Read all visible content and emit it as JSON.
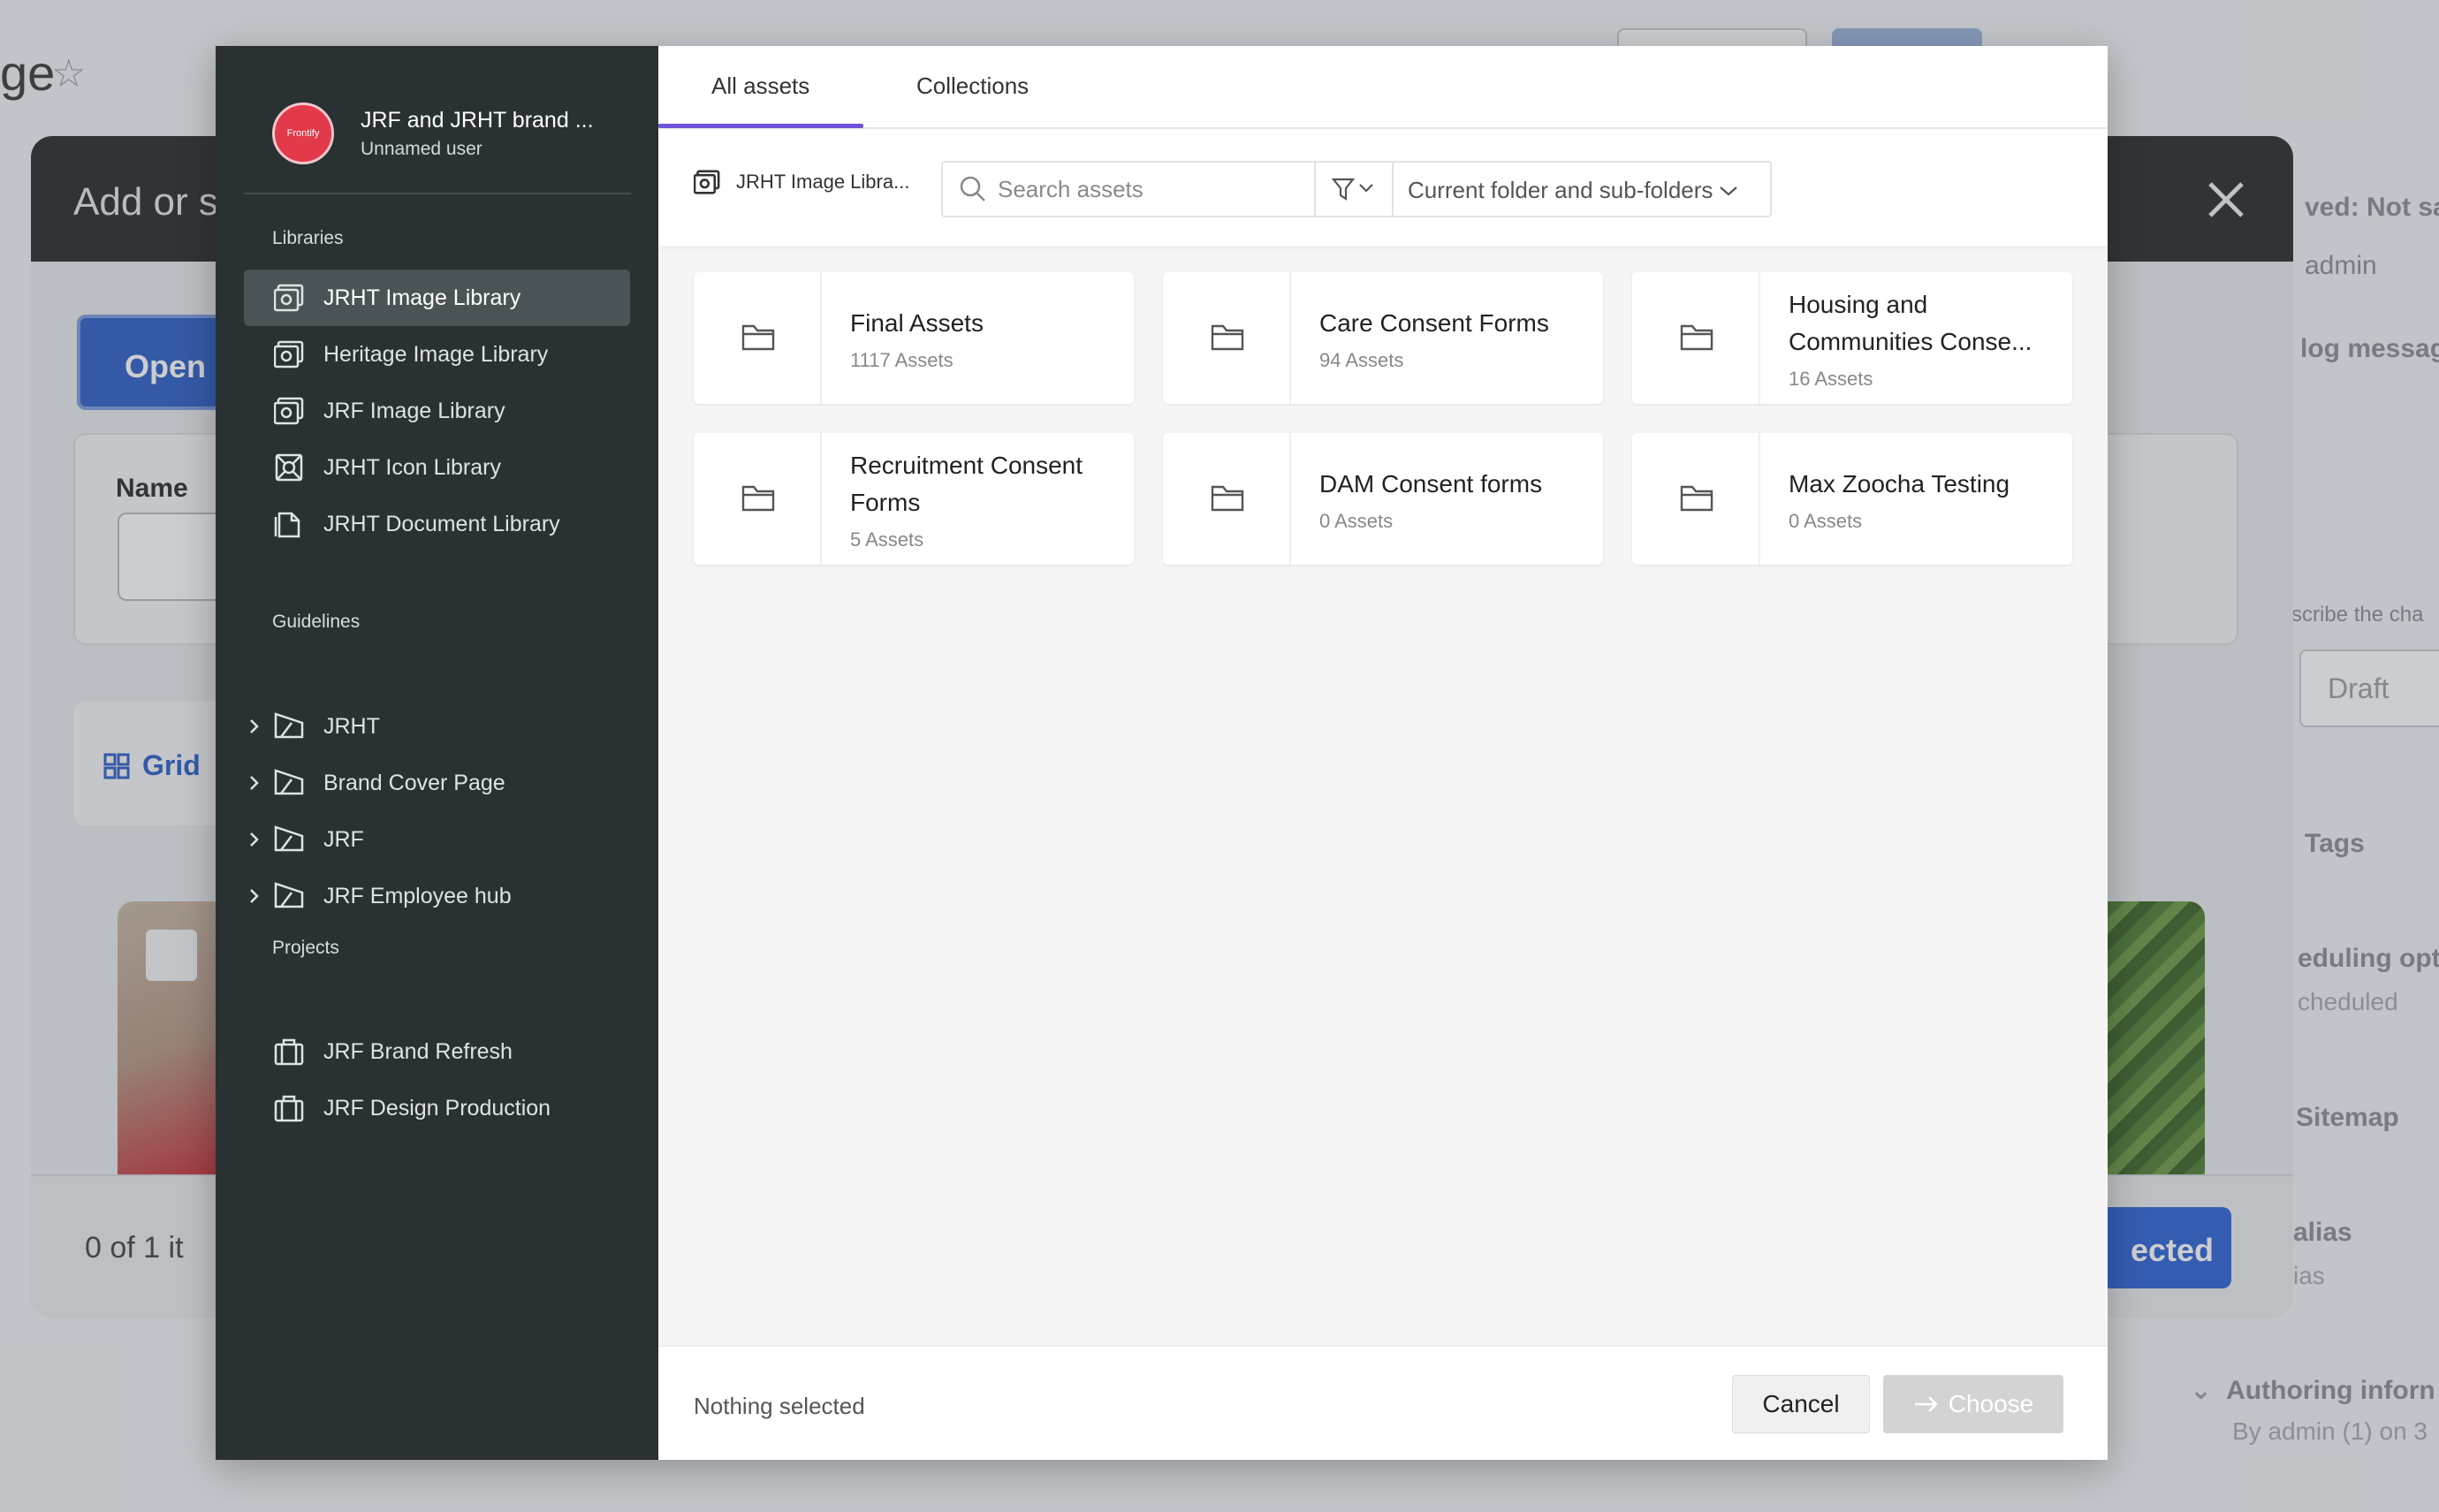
{
  "background_page": {
    "title_fragment": "ge",
    "right_texts": [
      "ved: Not sa",
      "admin",
      "log messag",
      "scribe the cha",
      "Draft",
      "Tags",
      "eduling optic",
      "cheduled",
      "Sitemap",
      "alias",
      "ias",
      "Authoring inforn",
      "By admin (1) on 3"
    ]
  },
  "middle_modal": {
    "title": "Add or se",
    "open_button_label": "Open F",
    "name_label": "Name",
    "grid_label": "Grid",
    "count_text": "0 of 1 it",
    "select_button_label": "ected"
  },
  "sidebar": {
    "brand": {
      "name": "JRF and JRHT brand ...",
      "user": "Unnamed user",
      "logo_text": "Frontify"
    },
    "libraries_title": "Libraries",
    "libraries": [
      {
        "label": "JRHT Image Library",
        "icon": "image-library-icon",
        "active": true
      },
      {
        "label": "Heritage Image Library",
        "icon": "image-library-icon",
        "active": false
      },
      {
        "label": "JRF Image Library",
        "icon": "image-library-icon",
        "active": false
      },
      {
        "label": "JRHT Icon Library",
        "icon": "icon-library-icon",
        "active": false
      },
      {
        "label": "JRHT Document Library",
        "icon": "document-library-icon",
        "active": false
      }
    ],
    "guidelines_title": "Guidelines",
    "guidelines": [
      {
        "label": "JRHT",
        "icon": "guideline-icon"
      },
      {
        "label": "Brand Cover Page",
        "icon": "guideline-icon"
      },
      {
        "label": "JRF",
        "icon": "guideline-icon"
      },
      {
        "label": "JRF Employee hub",
        "icon": "guideline-icon"
      }
    ],
    "projects_title": "Projects",
    "projects": [
      {
        "label": "JRF Brand Refresh",
        "icon": "project-icon"
      },
      {
        "label": "JRF Design Production",
        "icon": "project-icon"
      }
    ]
  },
  "tabs": [
    {
      "label": "All assets",
      "active": true
    },
    {
      "label": "Collections",
      "active": false
    }
  ],
  "toolbar": {
    "library_label": "JRHT Image Libra...",
    "search_placeholder": "Search assets",
    "scope_label": "Current folder and sub-folders"
  },
  "folders": [
    {
      "name": "Final Assets",
      "count": "1117 Assets"
    },
    {
      "name": "Care Consent Forms",
      "count": "94 Assets"
    },
    {
      "name": "Housing and Communities Conse...",
      "count": "16 Assets"
    },
    {
      "name": "Recruitment Consent Forms",
      "count": "5 Assets"
    },
    {
      "name": "DAM Consent forms",
      "count": "0 Assets"
    },
    {
      "name": "Max Zoocha Testing",
      "count": "0 Assets"
    }
  ],
  "footer": {
    "status": "Nothing selected",
    "cancel_label": "Cancel",
    "choose_label": "Choose"
  },
  "colors": {
    "sidebar_bg": "#293133",
    "sidebar_active": "#4a5457",
    "tab_accent": "#6e53d8",
    "brand_logo": "#e2394b",
    "choose_disabled": "#d3d3d3",
    "primary_blue": "#2f63d6"
  }
}
